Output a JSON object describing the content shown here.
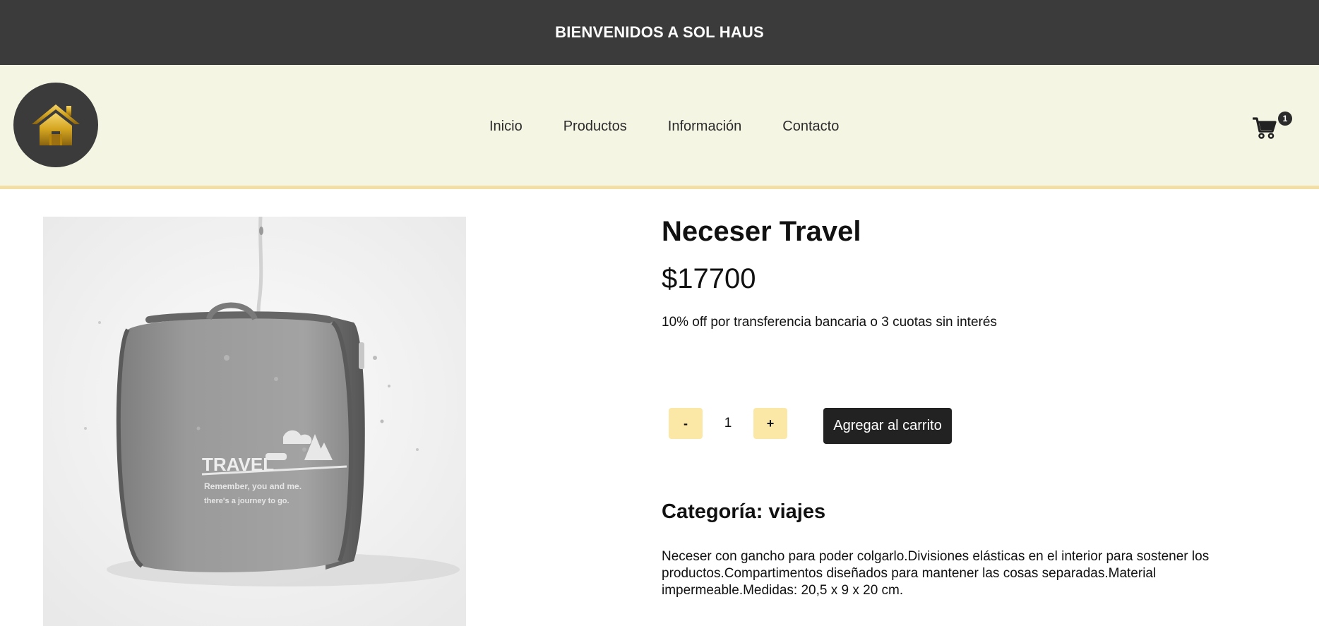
{
  "topbar": {
    "text": "BIENVENIDOS A SOL HAUS"
  },
  "navbar": {
    "logo_icon": "home-icon",
    "links": [
      {
        "label": "Inicio"
      },
      {
        "label": "Productos"
      },
      {
        "label": "Información"
      },
      {
        "label": "Contacto"
      }
    ],
    "cart": {
      "icon": "cart-icon",
      "count": "1"
    }
  },
  "product": {
    "title": "Neceser Travel",
    "price": "$17700",
    "promo": "10% off por transferencia bancaria o 3 cuotas sin interés",
    "quantity": {
      "decrement_label": "-",
      "value": "1",
      "increment_label": "+"
    },
    "add_to_cart_label": "Agregar al carrito",
    "category": "Categoría: viajes",
    "description": "Neceser con gancho para poder colgarlo.Divisiones elásticas en el interior para sostener los productos.Compartimentos diseñados para mantener las cosas separadas.Material impermeable.Medidas: 20,5 x 9 x 20 cm.",
    "image": {
      "print_title": "TRAVEL",
      "print_line1": "Remember, you and me.",
      "print_line2": "there's a journey to go."
    }
  },
  "colors": {
    "topbar_bg": "#3b3b3b",
    "navbar_bg": "#f5f5e4",
    "accent": "#fce8a6",
    "button_dark": "#222222",
    "gold": "#d4a520"
  }
}
